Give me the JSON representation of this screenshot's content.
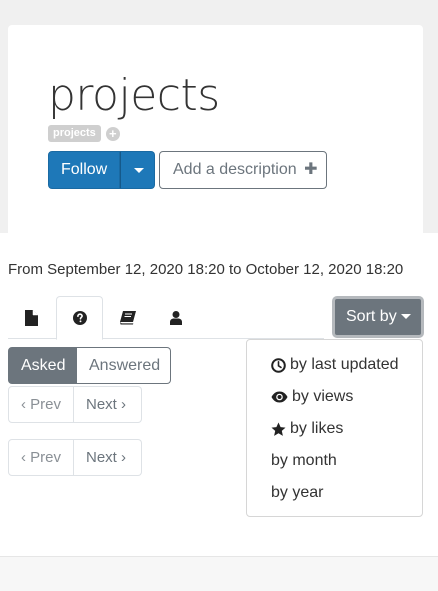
{
  "header": {
    "title": "projects",
    "tag": "projects",
    "tag_add_symbol": "+",
    "follow_label": "Follow",
    "add_description_label": "Add a description",
    "add_description_symbol": "✚"
  },
  "filter": {
    "date_range": "From September 12, 2020 18:20 to October 12, 2020 18:20"
  },
  "tabs": [
    {
      "icon": "document-icon",
      "active": false
    },
    {
      "icon": "question-circle-icon",
      "active": true
    },
    {
      "icon": "book-icon",
      "active": false
    },
    {
      "icon": "user-icon",
      "active": false
    }
  ],
  "sort": {
    "label": "Sort by",
    "options": [
      {
        "label": "by last updated",
        "icon": "clock-icon"
      },
      {
        "label": "by views",
        "icon": "eye-icon"
      },
      {
        "label": "by likes",
        "icon": "star-icon"
      },
      {
        "label": "by month",
        "icon": ""
      },
      {
        "label": "by year",
        "icon": ""
      }
    ]
  },
  "toggle": {
    "asked_label": "Asked",
    "answered_label": "Answered",
    "selected": "Asked"
  },
  "pagers": [
    {
      "prev_label": "‹ Prev",
      "next_label": "Next ›"
    },
    {
      "prev_label": "‹ Prev",
      "next_label": "Next ›"
    }
  ],
  "colors": {
    "primary": "#1e78b8",
    "secondary": "#6c757d"
  }
}
